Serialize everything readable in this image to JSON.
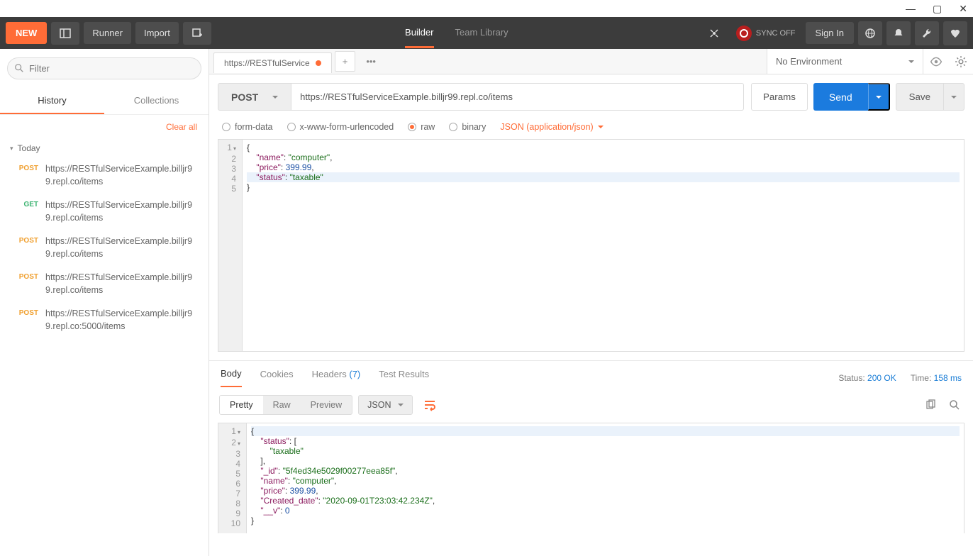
{
  "window": {
    "title": ""
  },
  "toolbar": {
    "new_label": "NEW",
    "runner_label": "Runner",
    "import_label": "Import",
    "builder_tab": "Builder",
    "team_library_tab": "Team Library",
    "sync_label": "SYNC OFF",
    "sign_in": "Sign In"
  },
  "sidebar": {
    "filter_placeholder": "Filter",
    "tabs": {
      "history": "History",
      "collections": "Collections"
    },
    "clear_all": "Clear all",
    "group_label": "Today",
    "items": [
      {
        "method": "POST",
        "url": "https://RESTfulServiceExample.billjr99.repl.co/items"
      },
      {
        "method": "GET",
        "url": "https://RESTfulServiceExample.billjr99.repl.co/items"
      },
      {
        "method": "POST",
        "url": "https://RESTfulServiceExample.billjr99.repl.co/items"
      },
      {
        "method": "POST",
        "url": "https://RESTfulServiceExample.billjr99.repl.co/items"
      },
      {
        "method": "POST",
        "url": "https://RESTfulServiceExample.billjr99.repl.co:5000/items"
      }
    ]
  },
  "env": {
    "request_tab_label": "https://RESTfulService",
    "selector": "No Environment"
  },
  "request": {
    "method": "POST",
    "url": "https://RESTfulServiceExample.billjr99.repl.co/items",
    "params_btn": "Params",
    "send_btn": "Send",
    "save_btn": "Save",
    "body_types": {
      "form_data": "form-data",
      "urlencoded": "x-www-form-urlencoded",
      "raw": "raw",
      "binary": "binary"
    },
    "raw_type": "JSON (application/json)",
    "body_lines": [
      "{",
      "    \"name\": \"computer\",",
      "    \"price\": 399.99,",
      "    \"status\": \"taxable\"",
      "}"
    ]
  },
  "response": {
    "tabs": {
      "body": "Body",
      "cookies": "Cookies",
      "headers": "Headers",
      "headers_count": "(7)",
      "tests": "Test Results"
    },
    "status_label": "Status:",
    "status_value": "200 OK",
    "time_label": "Time:",
    "time_value": "158 ms",
    "view": {
      "pretty": "Pretty",
      "raw": "Raw",
      "preview": "Preview"
    },
    "format": "JSON",
    "body_lines": [
      "{",
      "    \"status\": [",
      "        \"taxable\"",
      "    ],",
      "    \"_id\": \"5f4ed34e5029f00277eea85f\",",
      "    \"name\": \"computer\",",
      "    \"price\": 399.99,",
      "    \"Created_date\": \"2020-09-01T23:03:42.234Z\",",
      "    \"__v\": 0",
      "}"
    ]
  }
}
